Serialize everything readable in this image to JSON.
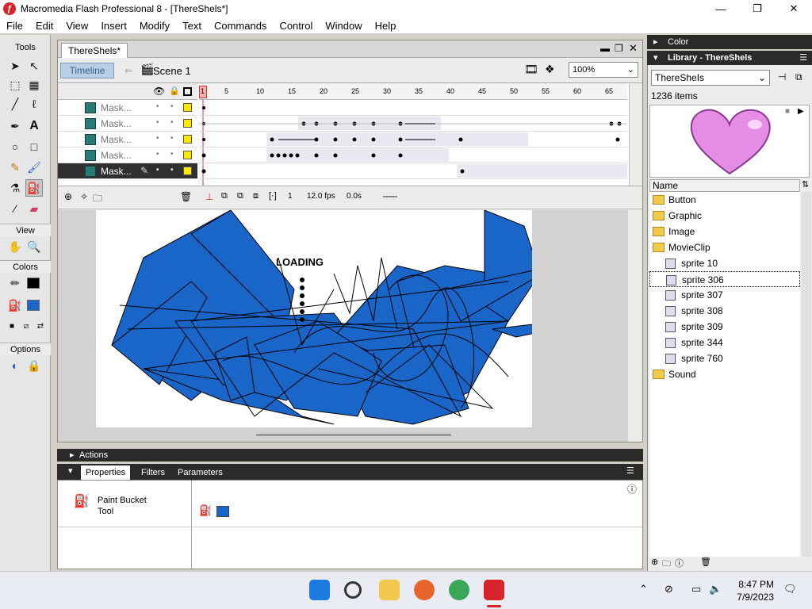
{
  "window": {
    "title": "Macromedia Flash Professional 8 - [ThereShels*]"
  },
  "menu": [
    "File",
    "Edit",
    "View",
    "Insert",
    "Modify",
    "Text",
    "Commands",
    "Control",
    "Window",
    "Help"
  ],
  "tools": {
    "header": "Tools",
    "view": "View",
    "colors": "Colors",
    "options": "Options"
  },
  "document": {
    "tab": "ThereShels*",
    "timeline_button": "Timeline",
    "scene": "Scene 1",
    "zoom": "100%"
  },
  "timeline": {
    "frame_numbers": [
      "1",
      "5",
      "10",
      "15",
      "20",
      "25",
      "30",
      "35",
      "40",
      "45",
      "50",
      "55",
      "60",
      "65"
    ],
    "layers": [
      "Mask...",
      "Mask...",
      "Mask...",
      "Mask...",
      "Mask..."
    ],
    "current_frame": "1",
    "fps": "12.0 fps",
    "time": "0.0s"
  },
  "stage": {
    "loading_text": "LOADING"
  },
  "panels": {
    "actions": "Actions",
    "properties_tabs": [
      "Properties",
      "Filters",
      "Parameters"
    ],
    "tool_name": "Paint Bucket Tool",
    "tool_name_line1": "Paint Bucket",
    "tool_name_line2": "Tool",
    "color": "Color",
    "library": "Library - ThereShels"
  },
  "library": {
    "selected_doc": "ThereSheIs",
    "count": "1236 items",
    "name_header": "Name",
    "items": [
      {
        "label": "Button",
        "kind": "folder"
      },
      {
        "label": "Graphic",
        "kind": "folder"
      },
      {
        "label": "Image",
        "kind": "folder"
      },
      {
        "label": "MovieClip",
        "kind": "folder-open"
      },
      {
        "label": "sprite 10",
        "kind": "symbol"
      },
      {
        "label": "sprite 306",
        "kind": "symbol",
        "selected": true
      },
      {
        "label": "sprite 307",
        "kind": "symbol"
      },
      {
        "label": "sprite 308",
        "kind": "symbol"
      },
      {
        "label": "sprite 309",
        "kind": "symbol"
      },
      {
        "label": "sprite 344",
        "kind": "symbol"
      },
      {
        "label": "sprite 760",
        "kind": "symbol"
      },
      {
        "label": "Sound",
        "kind": "folder"
      }
    ]
  },
  "taskbar": {
    "time": "8:47 PM",
    "date": "7/9/2023"
  },
  "colors": {
    "stage_fill": "#1a66c8",
    "heart": "#e58ce6",
    "timeline_button": "#b8cfe6"
  }
}
